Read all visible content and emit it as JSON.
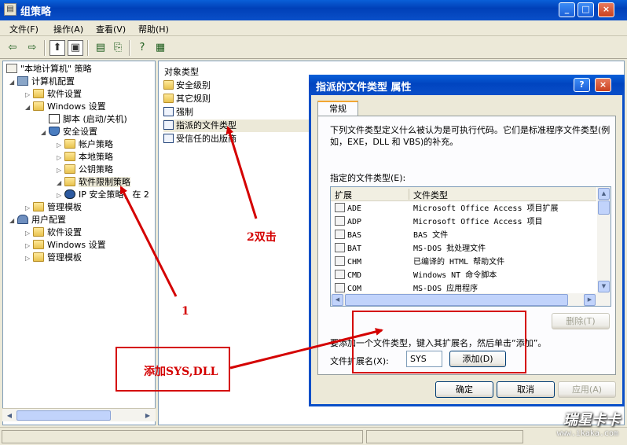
{
  "window": {
    "title": "组策略",
    "controls": [
      "_",
      "□",
      "×"
    ]
  },
  "menu": [
    "文件(F)",
    "操作(A)",
    "查看(V)",
    "帮助(H)"
  ],
  "toolbar": {
    "icons": [
      "back-arrow-icon",
      "forward-arrow-icon",
      "up-folder-icon",
      "show-tree-icon",
      "properties-icon",
      "refresh-icon",
      "export-list-icon",
      "help-icon",
      "console-icon"
    ],
    "glyphs": [
      "⇦",
      "⇨",
      "⬆",
      "▣",
      "▤",
      "⟲",
      "⎘",
      "?",
      "▦"
    ]
  },
  "tree": [
    {
      "label": "\"本地计算机\" 策略",
      "icon": "policy",
      "twisty": ""
    },
    {
      "label": "计算机配置",
      "icon": "computer",
      "twisty": "◢"
    },
    {
      "label": "软件设置",
      "icon": "folder",
      "twisty": "▷"
    },
    {
      "label": "Windows 设置",
      "icon": "folder",
      "twisty": "◢"
    },
    {
      "label": "脚本 (启动/关机)",
      "icon": "script",
      "twisty": ""
    },
    {
      "label": "安全设置",
      "icon": "shield",
      "twisty": "◢"
    },
    {
      "label": "帐户策略",
      "icon": "folder",
      "twisty": "▷"
    },
    {
      "label": "本地策略",
      "icon": "folder",
      "twisty": "▷"
    },
    {
      "label": "公钥策略",
      "icon": "folder",
      "twisty": "▷"
    },
    {
      "label": "软件限制策略",
      "icon": "folder",
      "twisty": "◢"
    },
    {
      "label": "IP 安全策略，在 2",
      "icon": "ipsec",
      "twisty": "▷"
    },
    {
      "label": "管理模板",
      "icon": "folder",
      "twisty": "▷"
    },
    {
      "label": "用户配置",
      "icon": "user",
      "twisty": "◢"
    },
    {
      "label": "软件设置",
      "icon": "folder",
      "twisty": "▷"
    },
    {
      "label": "Windows 设置",
      "icon": "folder",
      "twisty": "▷"
    },
    {
      "label": "管理模板",
      "icon": "folder",
      "twisty": "▷"
    }
  ],
  "list": {
    "header": "对象类型",
    "items": [
      {
        "label": "安全级别",
        "icon": "folder"
      },
      {
        "label": "其它规则",
        "icon": "folder"
      },
      {
        "label": "强制",
        "icon": "rule"
      },
      {
        "label": "指派的文件类型",
        "icon": "rule"
      },
      {
        "label": "受信任的出版商",
        "icon": "rule"
      }
    ]
  },
  "dialog": {
    "title": "指派的文件类型 属性",
    "help_button": "?",
    "close_button": "×",
    "tab": "常规",
    "description": "下列文件类型定义什么被认为是可执行代码。它们是标准程序文件类型(例如，EXE，DLL 和 VBS)的补充。",
    "list_label": "指定的文件类型(E):",
    "columns": [
      "扩展",
      "文件类型"
    ],
    "rows": [
      {
        "ext": "ADE",
        "type": "Microsoft Office Access 项目扩展"
      },
      {
        "ext": "ADP",
        "type": "Microsoft Office Access 项目"
      },
      {
        "ext": "BAS",
        "type": "BAS 文件"
      },
      {
        "ext": "BAT",
        "type": "MS-DOS 批处理文件"
      },
      {
        "ext": "CHM",
        "type": "已编译的 HTML 帮助文件"
      },
      {
        "ext": "CMD",
        "type": "Windows NT 命令脚本"
      },
      {
        "ext": "COM",
        "type": "MS-DOS 应用程序"
      }
    ],
    "remove_button": "删除(T)",
    "add_hint": "要添加一个文件类型，键入其扩展名，然后单击“添加”。",
    "ext_label": "文件扩展名(X):",
    "ext_value": "SYS",
    "add_button": "添加(D)",
    "ok_button": "确定",
    "cancel_button": "取消",
    "apply_button": "应用(A)"
  },
  "annotations": {
    "step1": "1",
    "step2": "2双击",
    "step3": "添加SYS,DLL",
    "color": "#d40000"
  },
  "watermark": {
    "brand": "瑞星卡卡",
    "url": "www.ikaka.com"
  },
  "colors": {
    "titlebar": "#0a4fc8",
    "face": "#ece9d8",
    "accent_tab": "#f2a633"
  }
}
